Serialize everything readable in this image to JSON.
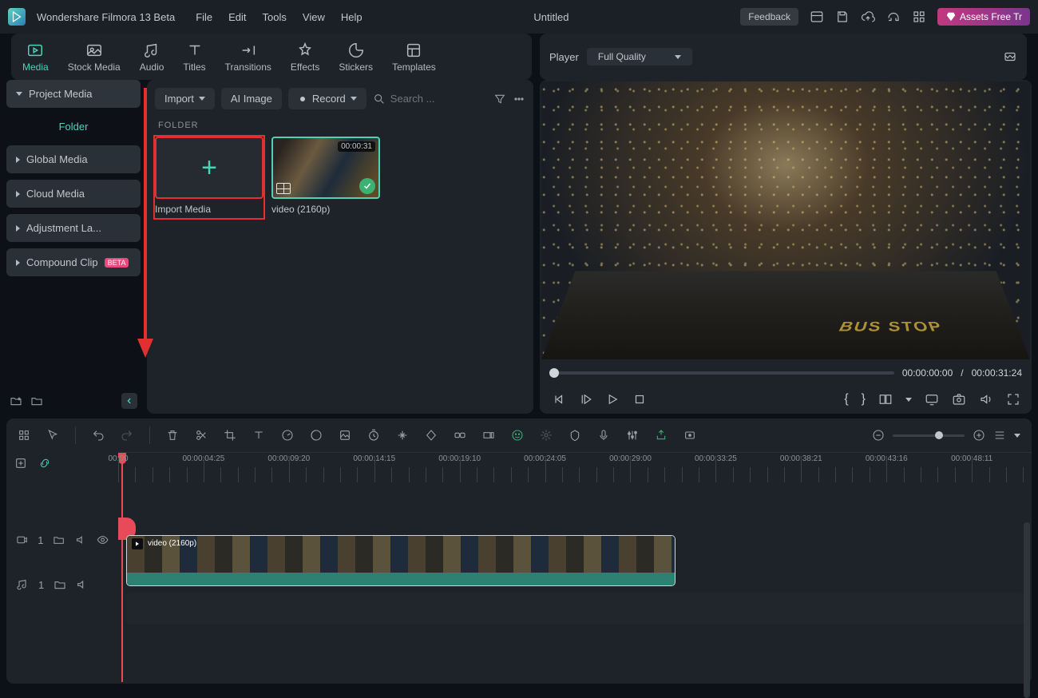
{
  "titlebar": {
    "app_name": "Wondershare Filmora 13 Beta",
    "menus": [
      "File",
      "Edit",
      "Tools",
      "View",
      "Help"
    ],
    "document_title": "Untitled",
    "feedback": "Feedback",
    "assets_label": "Assets Free Tr"
  },
  "ribbon": {
    "tabs": [
      {
        "label": "Media"
      },
      {
        "label": "Stock Media"
      },
      {
        "label": "Audio"
      },
      {
        "label": "Titles"
      },
      {
        "label": "Transitions"
      },
      {
        "label": "Effects"
      },
      {
        "label": "Stickers"
      },
      {
        "label": "Templates"
      }
    ],
    "player_label": "Player",
    "quality_label": "Full Quality"
  },
  "sidebar": {
    "project_media": "Project Media",
    "folder": "Folder",
    "items": [
      {
        "label": "Global Media"
      },
      {
        "label": "Cloud Media"
      },
      {
        "label": "Adjustment La..."
      },
      {
        "label": "Compound Clip",
        "beta": "BETA"
      }
    ]
  },
  "media_pane": {
    "import_btn": "Import",
    "ai_image_btn": "AI Image",
    "record_btn": "Record",
    "search_placeholder": "Search ...",
    "folder_label": "FOLDER",
    "import_tile": "Import Media",
    "clip": {
      "duration": "00:00:31",
      "name": "video (2160p)"
    }
  },
  "preview": {
    "bus_stop": "BUS\nSTOP",
    "current": "00:00:00:00",
    "sep": "/",
    "total": "00:00:31:24"
  },
  "timeline": {
    "clip_label": "video (2160p)",
    "video_track": "1",
    "audio_track": "1",
    "ruler": [
      "00:00",
      "00:00:04:25",
      "00:00:09:20",
      "00:00:14:15",
      "00:00:19:10",
      "00:00:24:05",
      "00:00:29:00",
      "00:00:33:25",
      "00:00:38:21",
      "00:00:43:16",
      "00:00:48:11"
    ]
  }
}
